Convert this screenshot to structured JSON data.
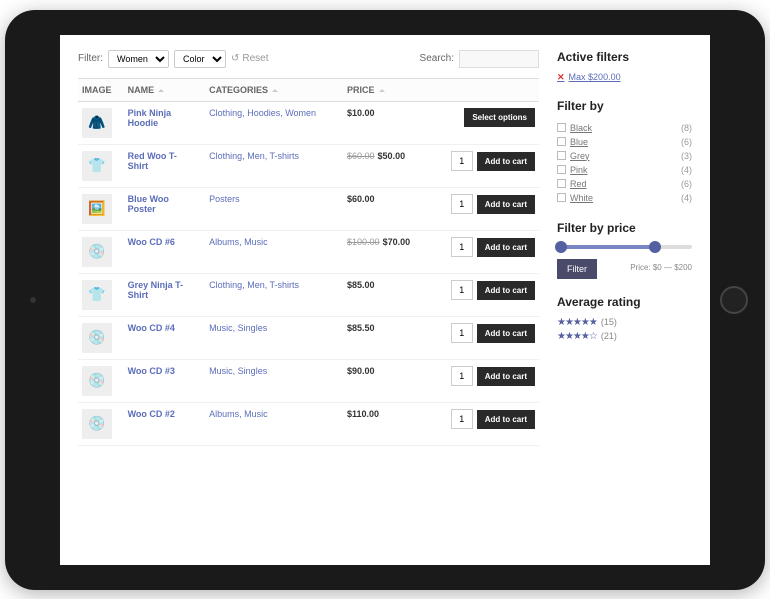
{
  "filterbar": {
    "label": "Filter:",
    "select1": "Women",
    "select2": "Color",
    "reset": "Reset",
    "searchLabel": "Search:"
  },
  "columns": {
    "image": "IMAGE",
    "name": "NAME",
    "categories": "CATEGORIES",
    "price": "PRICE"
  },
  "products": [
    {
      "name": "Pink Ninja Hoodie",
      "cats": "Clothing, Hoodies, Women",
      "price": "$10.00",
      "old": "",
      "action": "Select options",
      "qty": ""
    },
    {
      "name": "Red Woo T-Shirt",
      "cats": "Clothing, Men, T-shirts",
      "price": "$50.00",
      "old": "$60.00",
      "action": "Add to cart",
      "qty": "1"
    },
    {
      "name": "Blue Woo Poster",
      "cats": "Posters",
      "price": "$60.00",
      "old": "",
      "action": "Add to cart",
      "qty": "1"
    },
    {
      "name": "Woo CD #6",
      "cats": "Albums, Music",
      "price": "$70.00",
      "old": "$100.00",
      "action": "Add to cart",
      "qty": "1"
    },
    {
      "name": "Grey Ninja T-Shirt",
      "cats": "Clothing, Men, T-shirts",
      "price": "$85.00",
      "old": "",
      "action": "Add to cart",
      "qty": "1"
    },
    {
      "name": "Woo CD #4",
      "cats": "Music, Singles",
      "price": "$85.50",
      "old": "",
      "action": "Add to cart",
      "qty": "1"
    },
    {
      "name": "Woo CD #3",
      "cats": "Music, Singles",
      "price": "$90.00",
      "old": "",
      "action": "Add to cart",
      "qty": "1"
    },
    {
      "name": "Woo CD #2",
      "cats": "Albums, Music",
      "price": "$110.00",
      "old": "",
      "action": "Add to cart",
      "qty": "1"
    }
  ],
  "thumbs": [
    "🧥",
    "👕",
    "🖼️",
    "💿",
    "👕",
    "💿",
    "💿",
    "💿"
  ],
  "sidebar": {
    "activeFilters": {
      "title": "Active filters",
      "item": "Max $200.00"
    },
    "filterBy": {
      "title": "Filter by",
      "attrs": [
        {
          "label": "Black",
          "count": "(8)"
        },
        {
          "label": "Blue",
          "count": "(6)"
        },
        {
          "label": "Grey",
          "count": "(3)"
        },
        {
          "label": "Pink",
          "count": "(4)"
        },
        {
          "label": "Red",
          "count": "(6)"
        },
        {
          "label": "White",
          "count": "(4)"
        }
      ]
    },
    "filterPrice": {
      "title": "Filter by price",
      "button": "Filter",
      "range": "Price: $0 — $200"
    },
    "rating": {
      "title": "Average rating",
      "rows": [
        {
          "stars": "★★★★★",
          "count": "(15)"
        },
        {
          "stars": "★★★★☆",
          "count": "(21)"
        }
      ]
    }
  }
}
